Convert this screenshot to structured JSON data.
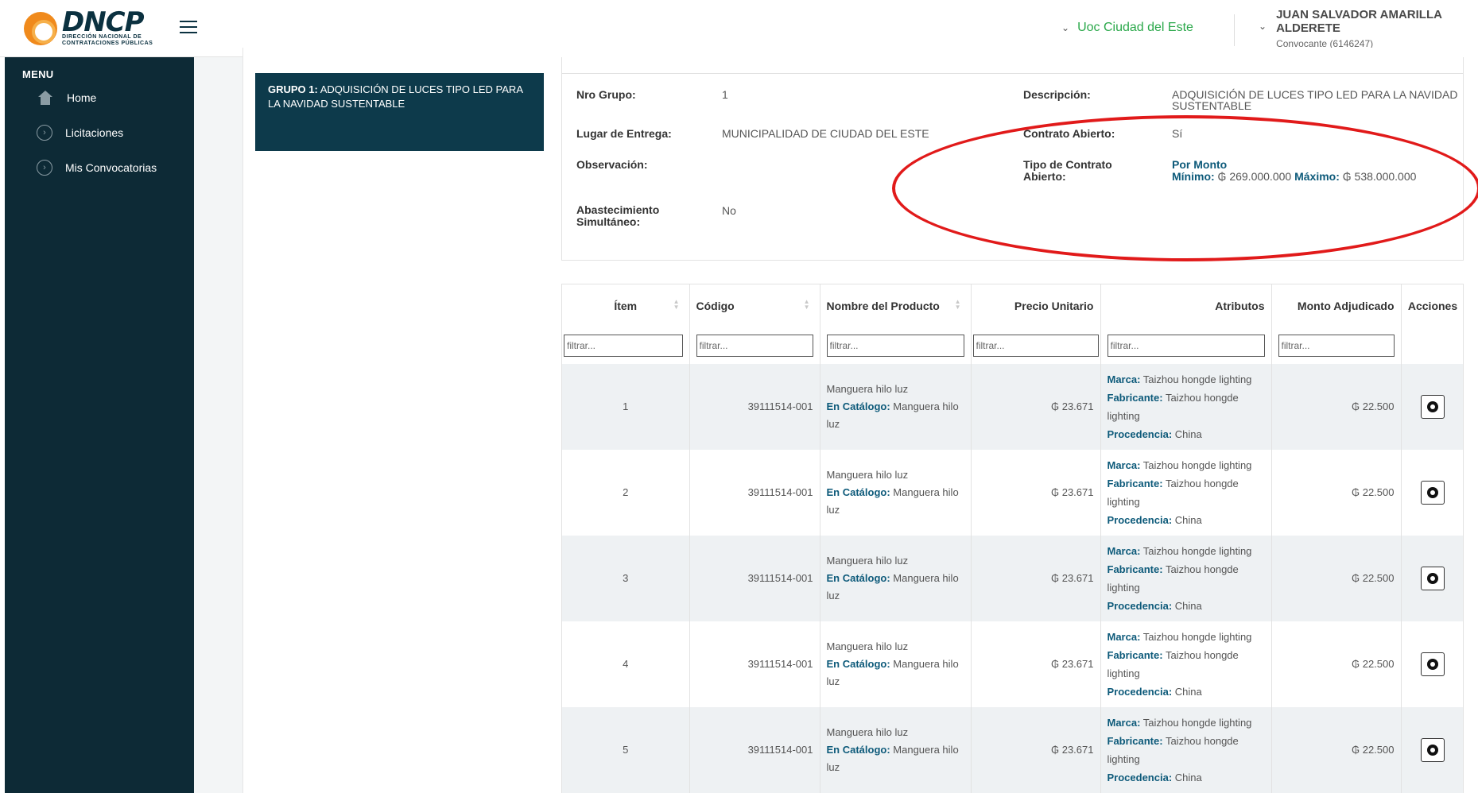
{
  "header": {
    "logo_text": "DNCP",
    "logo_subtitle_1": "DIRECCIÓN NACIONAL DE",
    "logo_subtitle_2": "CONTRATACIONES PÚBLICAS",
    "unit_select": "Uoc Ciudad del Este",
    "user_name": "JUAN SALVADOR AMARILLA ALDERETE",
    "user_role": "Convocante (6146247)"
  },
  "sidebar": {
    "menu_title": "MENU",
    "items": [
      {
        "label": "Home",
        "icon": "home-icon"
      },
      {
        "label": "Licitaciones",
        "icon": "chevron-circle-icon"
      },
      {
        "label": "Mis Convocatorias",
        "icon": "chevron-circle-icon"
      }
    ]
  },
  "group_card": {
    "prefix": "GRUPO 1:",
    "title": " ADQUISICIÓN DE LUCES TIPO LED PARA LA NAVIDAD SUSTENTABLE"
  },
  "details": {
    "nro_grupo_label": "Nro Grupo:",
    "nro_grupo_value": "1",
    "lugar_label": "Lugar de Entrega:",
    "lugar_value": "MUNICIPALIDAD DE CIUDAD DEL ESTE",
    "observacion_label": "Observación:",
    "observacion_value": "",
    "abastecimiento_label_1": "Abastecimiento",
    "abastecimiento_label_2": "Simultáneo:",
    "abastecimiento_value": "No",
    "descripcion_label": "Descripción:",
    "descripcion_value_1": "ADQUISICIÓN DE LUCES TIPO LED PARA LA NAVIDAD",
    "descripcion_value_2": "SUSTENTABLE",
    "contrato_abierto_label": "Contrato Abierto:",
    "contrato_abierto_value": "Sí",
    "tipo_contrato_label_1": "Tipo de Contrato",
    "tipo_contrato_label_2": "Abierto:",
    "tipo_contrato_value": "Por Monto",
    "minimo_label": "Mínimo:",
    "minimo_value": " ₲ 269.000.000 ",
    "maximo_label": "Máximo:",
    "maximo_value": " ₲ 538.000.000"
  },
  "table": {
    "columns": [
      "Ítem",
      "Código",
      "Nombre del Producto",
      "Precio Unitario",
      "Atributos",
      "Monto Adjudicado",
      "Acciones"
    ],
    "filter_placeholder": "filtrar...",
    "labels": {
      "catalogo": "En Catálogo:",
      "marca": "Marca:",
      "fabricante": "Fabricante:",
      "procedencia": "Procedencia:"
    },
    "rows": [
      {
        "item": "1",
        "codigo": "39111514-001",
        "nombre": "Manguera hilo luz",
        "catalogo": " Manguera hilo luz",
        "precio": "₲ 23.671",
        "marca": " Taizhou hongde lighting",
        "fabricante": " Taizhou hongde lighting",
        "procedencia": " China",
        "monto": "₲ 22.500"
      },
      {
        "item": "2",
        "codigo": "39111514-001",
        "nombre": "Manguera hilo luz",
        "catalogo": " Manguera hilo luz",
        "precio": "₲ 23.671",
        "marca": " Taizhou hongde lighting",
        "fabricante": " Taizhou hongde lighting",
        "procedencia": " China",
        "monto": "₲ 22.500"
      },
      {
        "item": "3",
        "codigo": "39111514-001",
        "nombre": "Manguera hilo luz",
        "catalogo": " Manguera hilo luz",
        "precio": "₲ 23.671",
        "marca": " Taizhou hongde lighting",
        "fabricante": " Taizhou hongde lighting",
        "procedencia": " China",
        "monto": "₲ 22.500"
      },
      {
        "item": "4",
        "codigo": "39111514-001",
        "nombre": "Manguera hilo luz",
        "catalogo": " Manguera hilo luz",
        "precio": "₲ 23.671",
        "marca": " Taizhou hongde lighting",
        "fabricante": " Taizhou hongde lighting",
        "procedencia": " China",
        "monto": "₲ 22.500"
      },
      {
        "item": "5",
        "codigo": "39111514-001",
        "nombre": "Manguera hilo luz",
        "catalogo": " Manguera hilo luz",
        "precio": "₲ 23.671",
        "marca": " Taizhou hongde lighting",
        "fabricante": " Taizhou hongde lighting",
        "procedencia": " China",
        "monto": "₲ 22.500"
      }
    ]
  },
  "colors": {
    "sidebar_bg": "#0d2a36",
    "group_card_bg": "#0d3a4b",
    "accent_green": "#2aa84a",
    "label_blue": "#0d5a7a",
    "annotation_red": "#e11a1a"
  }
}
